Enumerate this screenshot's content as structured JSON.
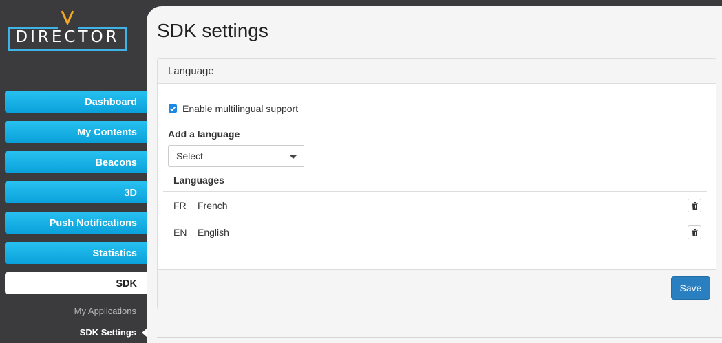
{
  "app": {
    "logo_text": "DIRECTOR"
  },
  "sidebar": {
    "items": [
      {
        "label": "Dashboard"
      },
      {
        "label": "My Contents"
      },
      {
        "label": "Beacons"
      },
      {
        "label": "3D"
      },
      {
        "label": "Push Notifications"
      },
      {
        "label": "Statistics"
      },
      {
        "label": "SDK",
        "active": true
      }
    ],
    "subitems": [
      {
        "label": "My Applications"
      },
      {
        "label": "SDK Settings",
        "current": true
      }
    ]
  },
  "main": {
    "title": "SDK settings",
    "panel": {
      "header": "Language",
      "multilingual_label": "Enable multilingual support",
      "multilingual_checked": true,
      "add_language_label": "Add a language",
      "select_value": "Select",
      "languages_header": "Languages",
      "languages": [
        {
          "code": "FR",
          "name": "French"
        },
        {
          "code": "EN",
          "name": "English"
        }
      ],
      "save_label": "Save"
    }
  },
  "colors": {
    "accent": "#1aa9e0",
    "sidebar_bg": "#3b3b3d",
    "save_button": "#2a7fc0"
  }
}
